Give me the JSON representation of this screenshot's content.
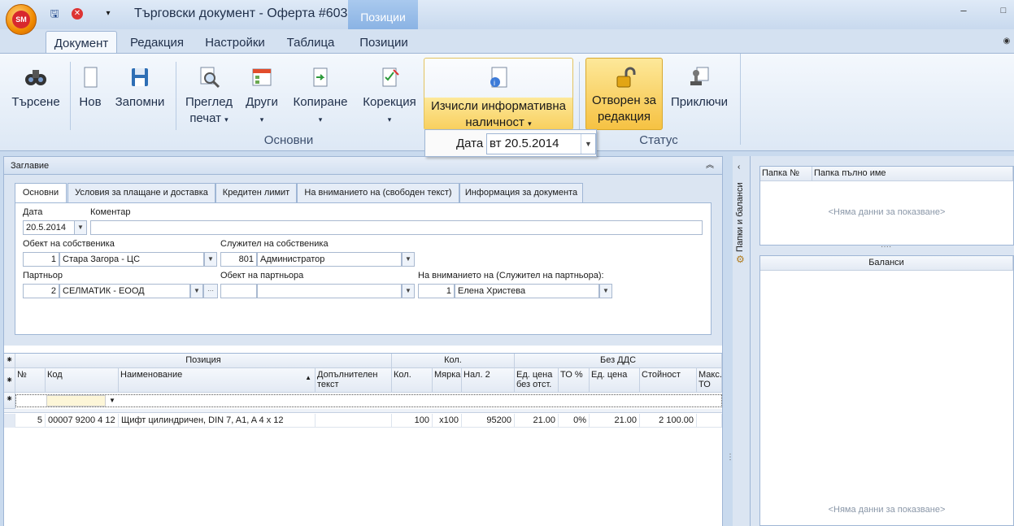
{
  "app": {
    "logo": "SM",
    "title": "Търговски документ - Оферта #603",
    "context_tab": "Позиции"
  },
  "quick_access": [
    "save-icon",
    "close-icon",
    "customize-icon"
  ],
  "ribbon_tabs": [
    "Документ",
    "Редакция",
    "Настройки",
    "Таблица",
    "Позиции"
  ],
  "ribbon": {
    "search": "Търсене",
    "new": "Нов",
    "save": "Запомни",
    "preview_l1": "Преглед",
    "preview_l2": "печат",
    "other": "Други",
    "copy": "Копиране",
    "correction": "Корекция",
    "calc_l1": "Изчисли информативна",
    "calc_l2": "наличност",
    "group_main": "Основни",
    "status_l1": "Отворен за",
    "status_l2": "редакция",
    "finish": "Приключи",
    "group_status": "Статус"
  },
  "date_popup": {
    "label": "Дата",
    "value": "вт 20.5.2014"
  },
  "header_panel": {
    "title": "Заглавие",
    "tabs": [
      "Основни",
      "Условия за плащане и доставка",
      "Кредитен лимит",
      "На вниманието на (свободен текст)",
      "Информация за документа"
    ],
    "date_label": "Дата",
    "date_value": "20.5.2014",
    "comment_label": "Коментар",
    "comment_value": "",
    "owner_object_label": "Обект на собственика",
    "owner_object_code": "1",
    "owner_object_name": "Стара Загора - ЦС",
    "owner_employee_label": "Служител на собственика",
    "owner_employee_code": "801",
    "owner_employee_name": "Администратор",
    "partner_label": "Партньор",
    "partner_code": "2",
    "partner_name": "СЕЛМАТИК - ЕООД",
    "partner_object_label": "Обект на партньора",
    "partner_object_code": "",
    "partner_object_name": "",
    "attention_label": "На вниманието на (Служител на партньора):",
    "attention_code": "1",
    "attention_name": "Елена Христева"
  },
  "grid": {
    "bands": [
      "Позиция",
      "Кол.",
      "Без ДДС"
    ],
    "columns": [
      "№",
      "Код",
      "Наименование",
      "Допълнителен текст",
      "Кол.",
      "Мярка",
      "Нал. 2",
      "Ед. цена без отст.",
      "ТО %",
      "Ед. цена",
      "Стойност",
      "Макс. ТО"
    ],
    "rows": [
      {
        "no": "5",
        "code": "00007 9200 4 12",
        "name": "Щифт цилиндричен, DIN 7, A1, A 4 x 12",
        "extra": "",
        "qty": "100",
        "unit": "x100",
        "avail": "95200",
        "price_nodisc": "21.00",
        "disc": "0%",
        "price": "21.00",
        "value": "2 100.00",
        "max": ""
      }
    ]
  },
  "right_panel": {
    "vertical_tab": "Папки и баланси",
    "folders_cols": [
      "Папка №",
      "Папка пълно име"
    ],
    "balances_title": "Баланси",
    "no_data": "<Няма данни за показване>"
  }
}
